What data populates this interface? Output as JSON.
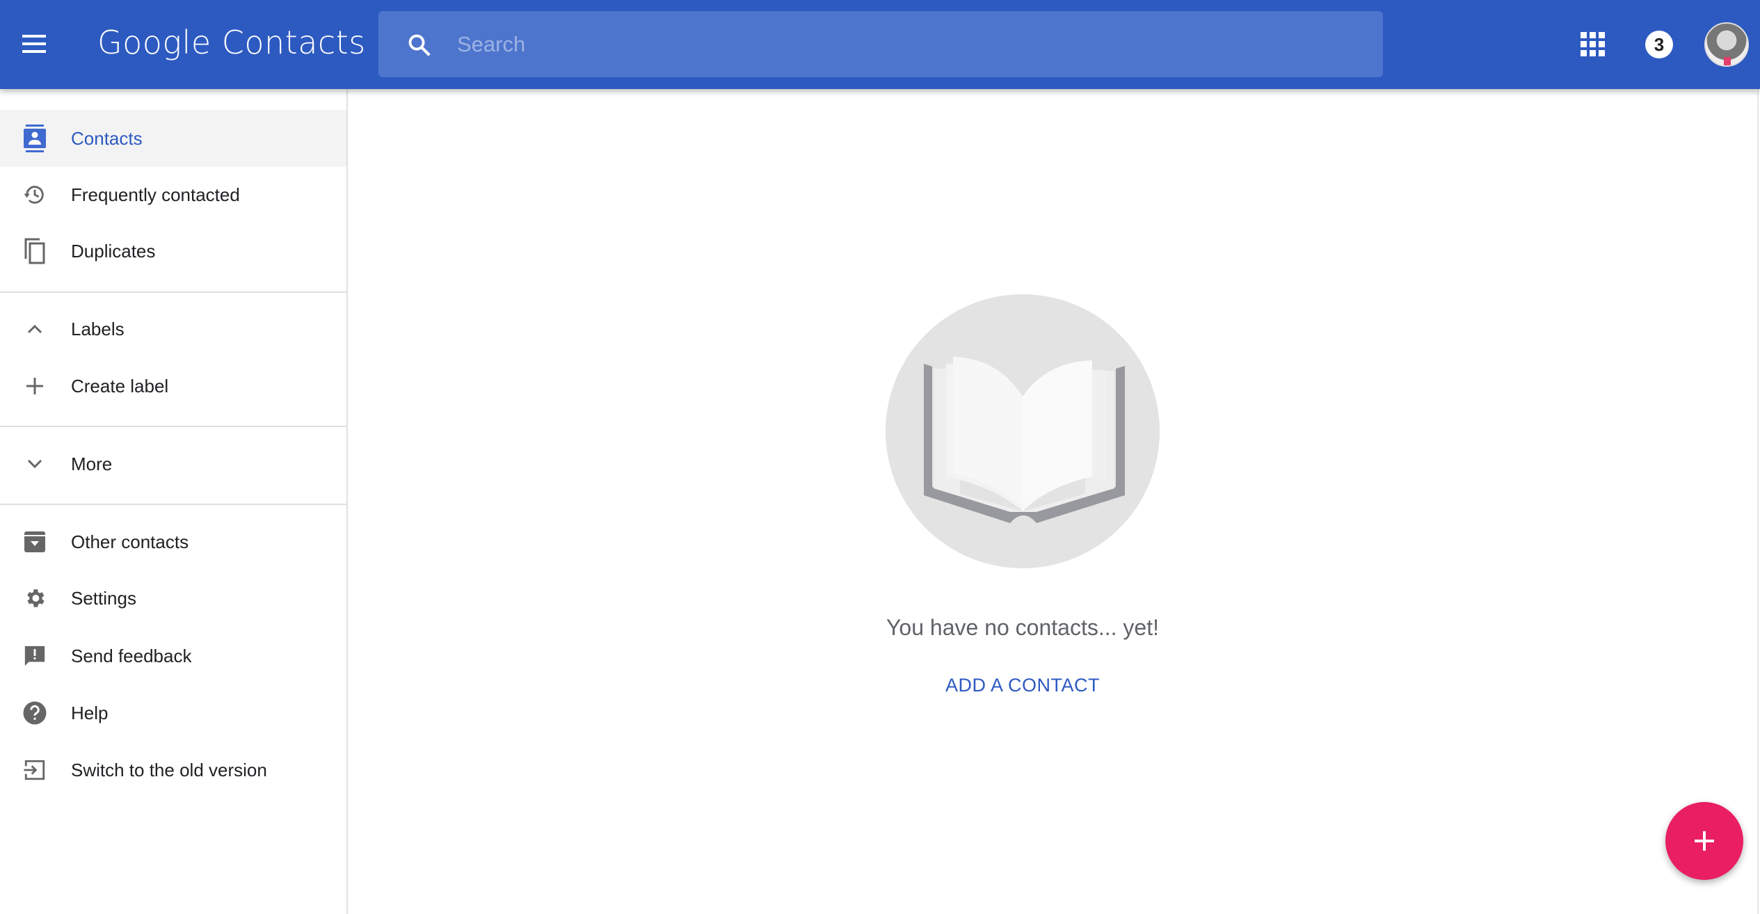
{
  "header": {
    "app_title": "Google Contacts",
    "search_placeholder": "Search",
    "notification_count": "3"
  },
  "sidebar": {
    "items": [
      {
        "label": "Contacts",
        "icon": "contacts-icon",
        "active": true
      },
      {
        "label": "Frequently contacted",
        "icon": "history-icon"
      },
      {
        "label": "Duplicates",
        "icon": "copy-icon"
      },
      {
        "label": "Labels",
        "icon": "chevron-up-icon"
      },
      {
        "label": "Create label",
        "icon": "plus-icon"
      },
      {
        "label": "More",
        "icon": "chevron-down-icon"
      },
      {
        "label": "Other contacts",
        "icon": "archive-icon"
      },
      {
        "label": "Settings",
        "icon": "gear-icon"
      },
      {
        "label": "Send feedback",
        "icon": "feedback-icon"
      },
      {
        "label": "Help",
        "icon": "help-icon"
      },
      {
        "label": "Switch to the old version",
        "icon": "exit-icon"
      }
    ]
  },
  "main": {
    "empty_message": "You have no contacts... yet!",
    "add_contact_label": "ADD A CONTACT"
  },
  "colors": {
    "header": "#2d5ac1",
    "accent": "#2d5ac1",
    "fab": "#e91e63"
  }
}
